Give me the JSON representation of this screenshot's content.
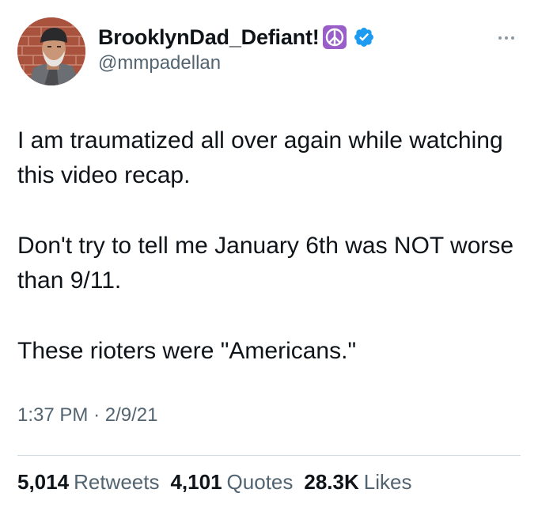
{
  "author": {
    "display_name": "BrooklynDad_Defiant!",
    "handle": "@mmpadellan",
    "emoji_icon": "peace-symbol",
    "verified_icon": "verified-badge",
    "verified_color": "#1d9bf0"
  },
  "tweet": {
    "paragraphs": [
      "I am traumatized all over again while watching this video recap.",
      "Don't try to tell me January 6th was NOT worse than 9/11.",
      "These rioters were \"Americans.\""
    ],
    "time": "1:37 PM",
    "separator": "·",
    "date": "2/9/21"
  },
  "stats": {
    "retweets_count": "5,014",
    "retweets_label": "Retweets",
    "quotes_count": "4,101",
    "quotes_label": "Quotes",
    "likes_count": "28.3K",
    "likes_label": "Likes"
  },
  "colors": {
    "text": "#0f1419",
    "secondary": "#536471",
    "divider": "#cfd9de",
    "peace_bg": "#9a5ec9"
  }
}
